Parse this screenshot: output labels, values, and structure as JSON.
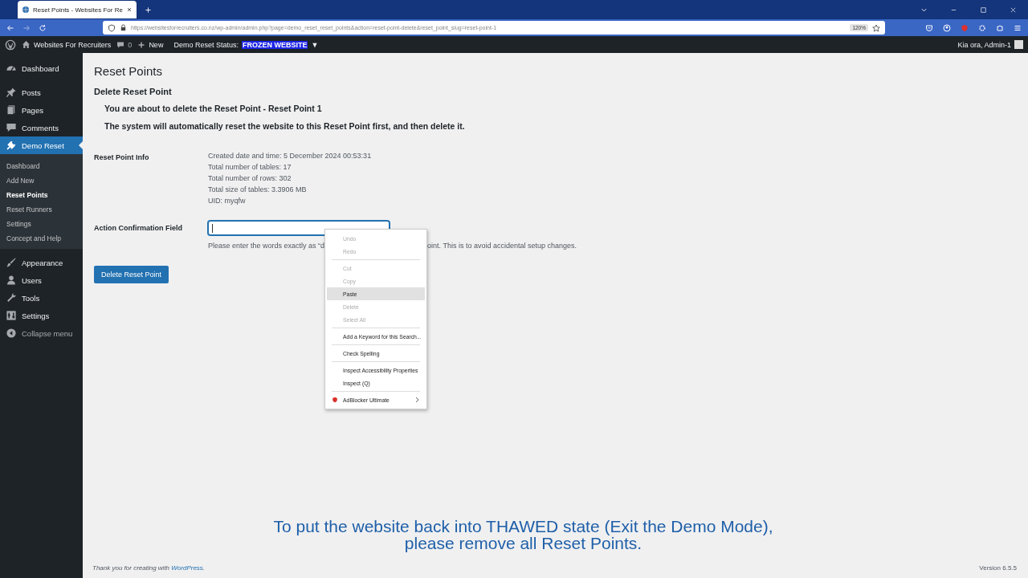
{
  "browser": {
    "tab_title": "Reset Points - Websites For Re",
    "url": "https://websitesforrecruiters.co.nz/wp-admin/admin.php?page=demo_reset_reset_points&action=reset-point-delete&reset_point_slug=reset-point-1",
    "zoom": "120%"
  },
  "admin_bar": {
    "site": "Websites For Recruiters",
    "comments": "0",
    "new": "New",
    "status_label": "Demo Reset Status:",
    "status_value": "FROZEN WEBSITE",
    "caret": "▼",
    "greeting": "Kia ora, Admin-1"
  },
  "sidebar": {
    "items": [
      {
        "label": "Dashboard",
        "selected": false
      },
      {
        "label": "Posts",
        "selected": false
      },
      {
        "label": "Pages",
        "selected": false
      },
      {
        "label": "Comments",
        "selected": false
      },
      {
        "label": "Demo Reset",
        "selected": true,
        "children": [
          {
            "label": "Dashboard",
            "selected": false
          },
          {
            "label": "Add New",
            "selected": false
          },
          {
            "label": "Reset Points",
            "selected": true
          },
          {
            "label": "Reset Runners",
            "selected": false
          },
          {
            "label": "Settings",
            "selected": false
          },
          {
            "label": "Concept and Help",
            "selected": false
          }
        ]
      },
      {
        "label": "Appearance",
        "selected": false
      },
      {
        "label": "Users",
        "selected": false
      },
      {
        "label": "Tools",
        "selected": false
      },
      {
        "label": "Settings",
        "selected": false
      },
      {
        "label": "Collapse menu",
        "selected": false
      }
    ]
  },
  "page": {
    "title": "Reset Points",
    "subtitle": "Delete Reset Point",
    "notices": [
      "You are about to delete the Reset Point - Reset Point 1",
      "The system will automatically reset the website to this Reset Point first, and then delete it."
    ],
    "info_label": "Reset Point Info",
    "info_lines": [
      "Created date and time: 5 December 2024 00:53:31",
      "Total number of tables: 17",
      "Total number of rows: 302",
      "Total size of tables: 3.3906 MB",
      "UID: myqfw"
    ],
    "field_label": "Action Confirmation Field",
    "hint_start": "Please enter the words exactly as “d",
    "hint_end": "oint. This is to avoid accidental setup changes.",
    "button": "Delete Reset Point"
  },
  "context_menu": [
    {
      "kind": "item",
      "label": "Undo",
      "disabled": true,
      "selected": false
    },
    {
      "kind": "item",
      "label": "Redo",
      "disabled": true,
      "selected": false
    },
    {
      "kind": "separator"
    },
    {
      "kind": "item",
      "label": "Cut",
      "disabled": true,
      "selected": false
    },
    {
      "kind": "item",
      "label": "Copy",
      "disabled": true,
      "selected": false
    },
    {
      "kind": "item",
      "label": "Paste",
      "disabled": false,
      "selected": true
    },
    {
      "kind": "item",
      "label": "Delete",
      "disabled": true,
      "selected": false
    },
    {
      "kind": "item",
      "label": "Select All",
      "disabled": true,
      "selected": false
    },
    {
      "kind": "separator"
    },
    {
      "kind": "item",
      "label": "Add a Keyword for this Search...",
      "disabled": false,
      "selected": false
    },
    {
      "kind": "separator"
    },
    {
      "kind": "item",
      "label": "Check Spelling",
      "disabled": false,
      "selected": false
    },
    {
      "kind": "separator"
    },
    {
      "kind": "item",
      "label": "Inspect Accessibility Properties",
      "disabled": false,
      "selected": false
    },
    {
      "kind": "item",
      "label": "Inspect (Q)",
      "disabled": false,
      "selected": false
    },
    {
      "kind": "separator"
    },
    {
      "kind": "submenu",
      "label": "AdBlocker Ultimate",
      "disabled": false,
      "selected": false
    }
  ],
  "caption": [
    "To put the website back into THAWED state (Exit the Demo Mode),",
    "please remove all Reset Points."
  ],
  "footer": {
    "text": "Thank you for creating with ",
    "link": "WordPress",
    "end": ".",
    "version": "Version 6.5.5"
  }
}
